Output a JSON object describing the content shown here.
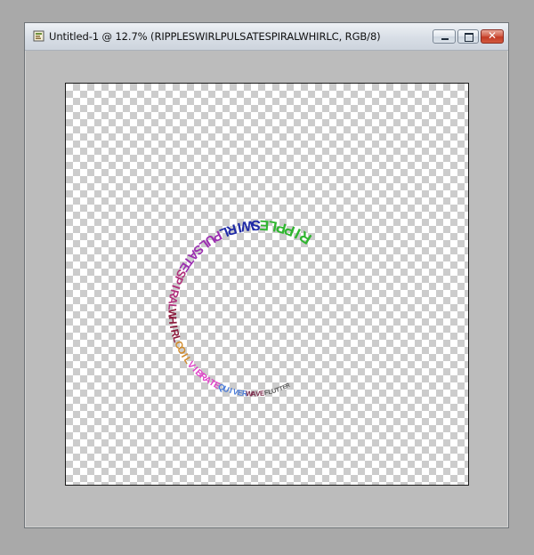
{
  "window": {
    "title": "Untitled-1 @ 12.7% (RIPPLESWIRLPULSATESPIRALWHIRLC, RGB/8)",
    "controls": {
      "close_glyph": "✕"
    }
  },
  "canvas": {
    "background": "transparency-checkerboard",
    "spiral_text": {
      "segments": [
        {
          "text": "RIPPLE",
          "color": "#2fb52f"
        },
        {
          "text": "SWIRL",
          "color": "#1f2aa6"
        },
        {
          "text": "PULSATE",
          "color": "#9b2fb0"
        },
        {
          "text": "SPIRAL",
          "color": "#b0307b"
        },
        {
          "text": "WHIRL",
          "color": "#8c1a3c"
        },
        {
          "text": "COIL",
          "color": "#d08a2a"
        },
        {
          "text": "VIBRATE",
          "color": "#e040c8"
        },
        {
          "text": "QUIVER",
          "color": "#4a7bd8"
        },
        {
          "text": "WAVE",
          "color": "#7a2a4a"
        },
        {
          "text": "FLUTTER",
          "color": "#555555"
        }
      ]
    }
  }
}
